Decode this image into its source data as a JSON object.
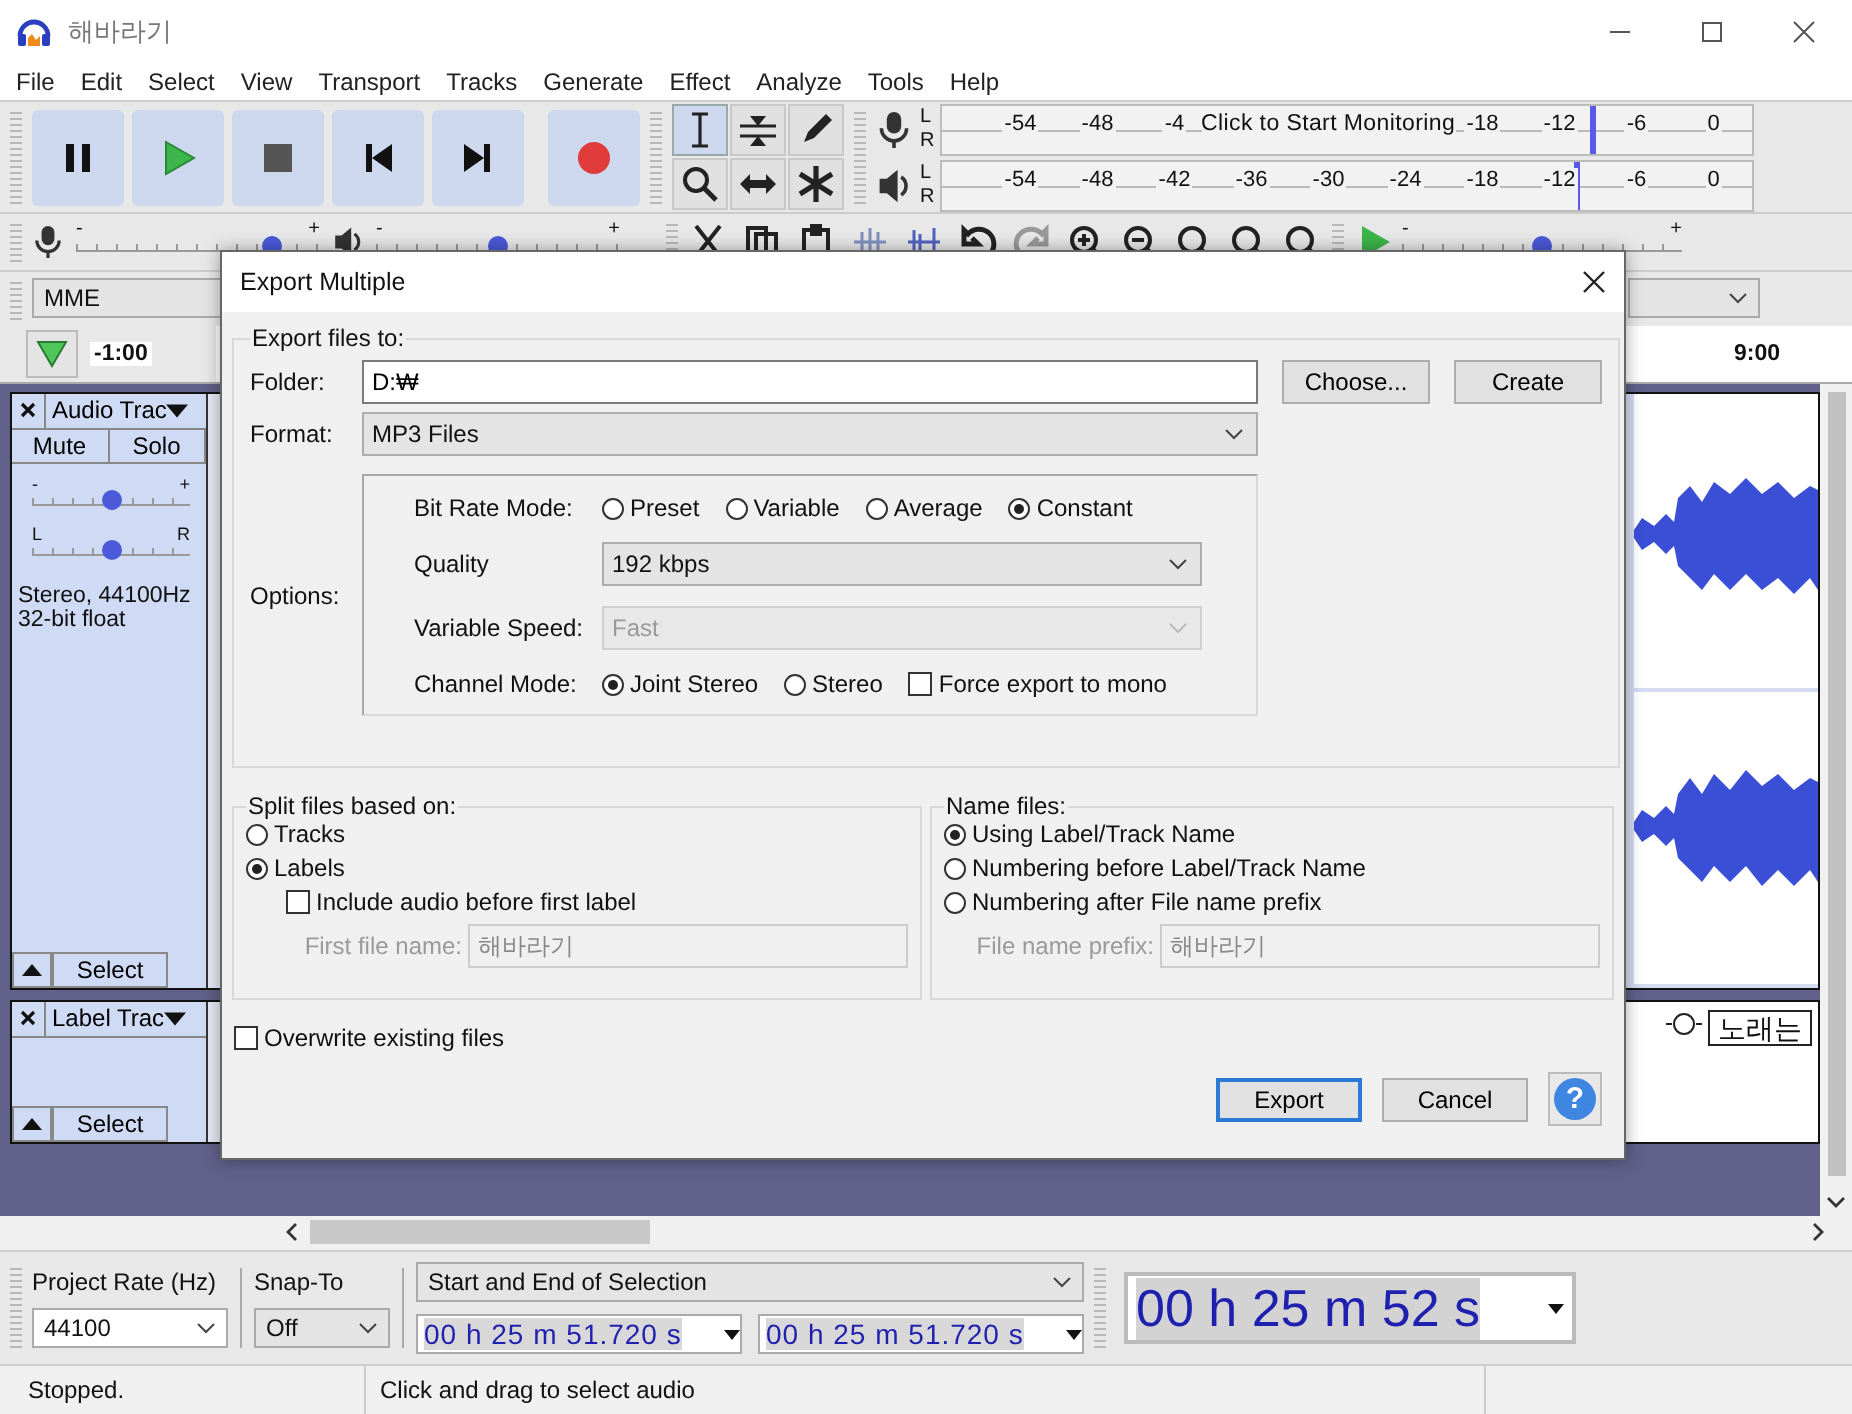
{
  "window": {
    "title": "해바라기"
  },
  "menu": [
    "File",
    "Edit",
    "Select",
    "View",
    "Transport",
    "Tracks",
    "Generate",
    "Effect",
    "Analyze",
    "Tools",
    "Help"
  ],
  "transport": [
    {
      "kind": "pause"
    },
    {
      "kind": "play"
    },
    {
      "kind": "stop"
    },
    {
      "kind": "skip_start"
    },
    {
      "kind": "skip_end"
    },
    {
      "kind": "record"
    }
  ],
  "tools": [
    {
      "kind": "select",
      "selected": true
    },
    {
      "kind": "envelope",
      "selected": false
    },
    {
      "kind": "draw",
      "selected": false
    },
    {
      "kind": "zoom",
      "selected": false
    },
    {
      "kind": "timeshift",
      "selected": false
    },
    {
      "kind": "multi",
      "selected": false
    }
  ],
  "meters": [
    {
      "kind": "record",
      "channels": [
        "L",
        "R"
      ],
      "ticks_before": [
        "-54",
        "-48",
        "-4"
      ],
      "message": "Click to Start Monitoring",
      "ticks_after": [
        "-18",
        "-12",
        "-6",
        "0"
      ],
      "level": 0.8
    },
    {
      "kind": "playback",
      "channels": [
        "L",
        "R"
      ],
      "ticks_before": [
        "-54",
        "-48",
        "-42",
        "-36",
        "-30",
        "-24",
        "-18",
        "-12",
        "-6",
        "0"
      ],
      "level": 0.78
    }
  ],
  "mixer": [
    {
      "kind": "record",
      "min": "-",
      "max": "+",
      "level": 0.8
    },
    {
      "kind": "playback",
      "min": "-",
      "max": "+",
      "level": 0.5
    }
  ],
  "edit_tools": [
    {
      "kind": "cut"
    },
    {
      "kind": "copy"
    },
    {
      "kind": "paste"
    },
    {
      "kind": "trim"
    },
    {
      "kind": "silence"
    },
    {
      "kind": "undo"
    },
    {
      "kind": "redo"
    },
    {
      "kind": "zoom_in"
    },
    {
      "kind": "zoom_out"
    },
    {
      "kind": "fit_selection"
    },
    {
      "kind": "fit"
    },
    {
      "kind": "zoom_toggle"
    }
  ],
  "play_at_speed": {
    "min": "-",
    "max": "+",
    "level": 0.5
  },
  "device": {
    "host": "MME"
  },
  "timeline": {
    "start": "-1:00",
    "end": "9:00"
  },
  "audio_track": {
    "name": "Audio Trac",
    "mute": "Mute",
    "solo": "Solo",
    "gain": {
      "min": "-",
      "max": "+",
      "level": 0.5
    },
    "pan": {
      "min": "L",
      "max": "R",
      "level": 0.5
    },
    "info": "Stereo, 44100Hz\n32-bit float",
    "select": "Select"
  },
  "label_track": {
    "name": "Label Trac",
    "select": "Select",
    "label": "노래는"
  },
  "dialog": {
    "title": "Export Multiple",
    "export_to": {
      "legend": "Export files to:",
      "folder_label": "Folder:",
      "folder": "D:₩",
      "choose": "Choose...",
      "create": "Create",
      "format_label": "Format:",
      "format": "MP3 Files",
      "options_label": "Options:"
    },
    "options": {
      "bit_rate_label": "Bit Rate Mode:",
      "bit_rate_modes": [
        {
          "label": "Preset",
          "selected": false
        },
        {
          "label": "Variable",
          "selected": false
        },
        {
          "label": "Average",
          "selected": false
        },
        {
          "label": "Constant",
          "selected": true
        }
      ],
      "quality_label": "Quality",
      "quality": "192 kbps",
      "quality_disabled": false,
      "speed_label": "Variable Speed:",
      "speed": "Fast",
      "speed_disabled": true,
      "channel_label": "Channel Mode:",
      "channel_modes": [
        {
          "label": "Joint Stereo",
          "selected": true
        },
        {
          "label": "Stereo",
          "selected": false
        }
      ],
      "force_mono": {
        "label": "Force export to mono",
        "checked": false
      }
    },
    "split": {
      "legend": "Split files based on:",
      "choices": [
        {
          "label": "Tracks",
          "selected": false
        },
        {
          "label": "Labels",
          "selected": true
        }
      ],
      "include_audio": {
        "label": "Include audio before first label",
        "checked": false
      },
      "first_name_label": "First file name:",
      "first_name": "해바라기",
      "first_name_disabled": true
    },
    "name_files": {
      "legend": "Name files:",
      "choices": [
        {
          "label": "Using Label/Track Name",
          "selected": true
        },
        {
          "label": "Numbering before Label/Track Name",
          "selected": false
        },
        {
          "label": "Numbering after File name prefix",
          "selected": false
        }
      ],
      "prefix_label": "File name prefix:",
      "prefix": "해바라기",
      "prefix_disabled": true
    },
    "overwrite": {
      "label": "Overwrite existing files",
      "checked": false
    },
    "buttons": [
      {
        "label": "Export",
        "default": true
      },
      {
        "label": "Cancel",
        "default": false
      }
    ],
    "help": "?"
  },
  "selection_toolbar": {
    "rate_label": "Project Rate (Hz)",
    "rate": "44100",
    "snap_label": "Snap-To",
    "snap": "Off",
    "mode": "Start and End of Selection",
    "start": "00 h 25 m 51.720 s",
    "end": "00 h 25 m 51.720 s",
    "position": "00 h 25 m 52 s"
  },
  "status_bar": [
    "Stopped.",
    "Click and drag to select audio"
  ]
}
